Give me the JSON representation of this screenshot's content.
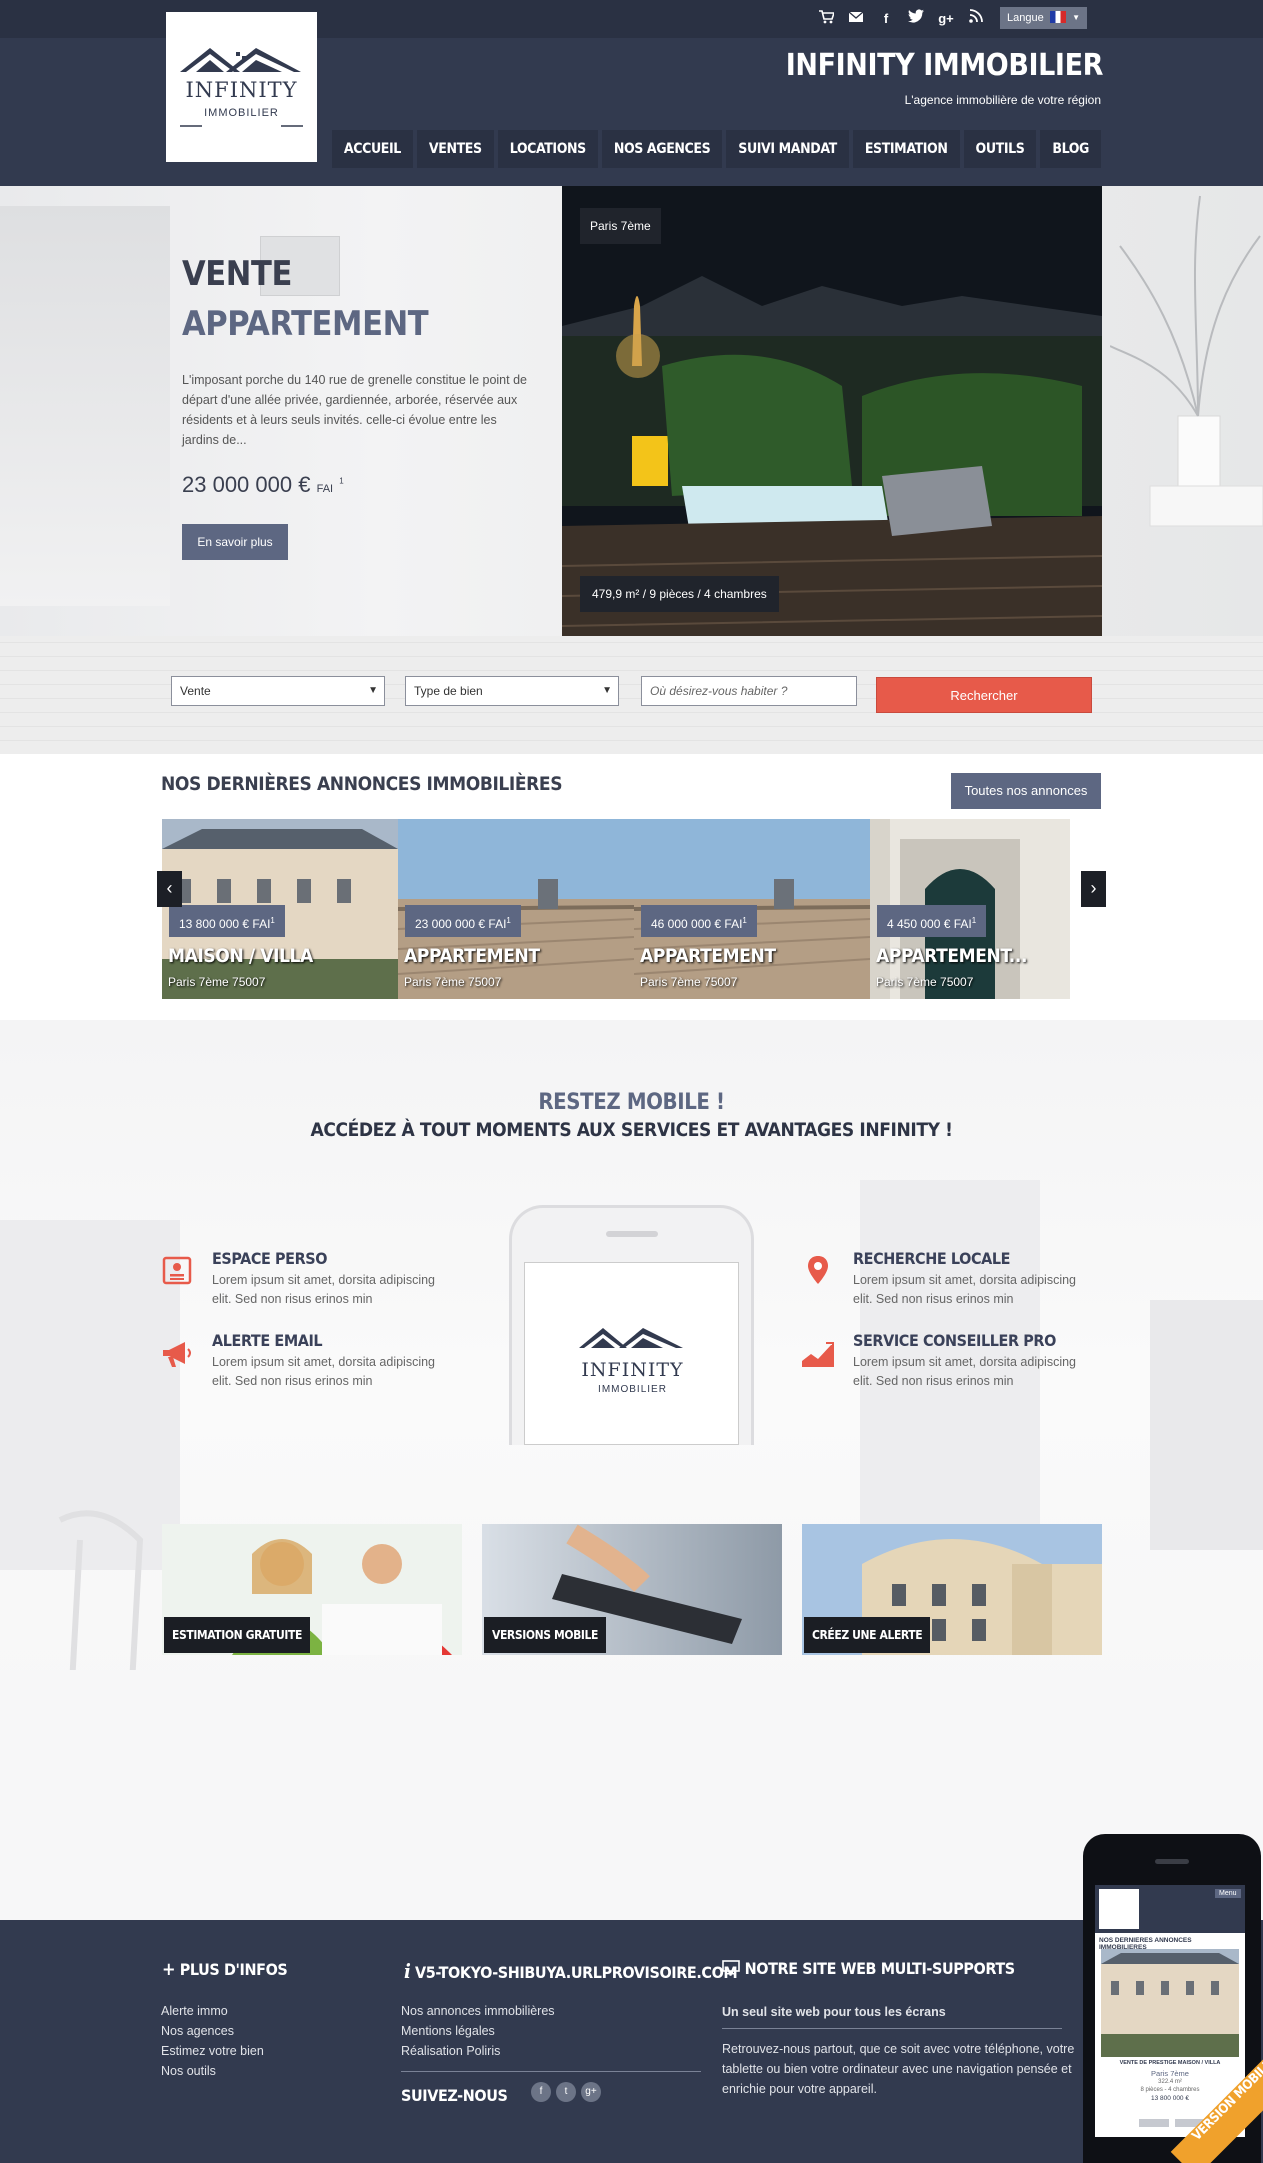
{
  "header": {
    "site_title": "INFINITY IMMOBILIER",
    "tagline": "L'agence immobilière de votre région",
    "logo_line1": "INFINITY",
    "logo_line2": "IMMOBILIER",
    "language_label": "Langue",
    "top_icons": [
      "cart-icon",
      "mail-icon",
      "facebook-icon",
      "twitter-icon",
      "googleplus-icon",
      "rss-icon"
    ],
    "nav": [
      "ACCUEIL",
      "VENTES",
      "LOCATIONS",
      "NOS AGENCES",
      "SUIVI MANDAT",
      "ESTIMATION",
      "OUTILS",
      "BLOG"
    ]
  },
  "hero": {
    "title_line1": "VENTE",
    "title_line2": "APPARTEMENT",
    "description": "L'imposant porche du 140 rue de grenelle constitue le point de départ d'une allée privée, gardiennée, arborée, réservée aux résidents et à leurs seuls invités. celle-ci évolue entre les jardins de...",
    "price": "23 000 000 €",
    "price_suffix": "FAI",
    "price_note": "1",
    "button": "En savoir plus",
    "location": "Paris 7ème",
    "specs": "479,9 m² / 9 pièces / 4 chambres"
  },
  "search": {
    "transaction": "Vente",
    "property_type": "Type de bien",
    "location_placeholder": "Où désirez-vous habiter ?",
    "button": "Rechercher"
  },
  "listings": {
    "title": "NOS DERNIÈRES ANNONCES IMMOBILIÈRES",
    "all_button": "Toutes nos annonces",
    "items": [
      {
        "price": "13 800 000 € FAI",
        "note": "1",
        "type": "MAISON / VILLA",
        "location": "Paris 7ème 75007"
      },
      {
        "price": "23 000 000 € FAI",
        "note": "1",
        "type": "APPARTEMENT",
        "location": "Paris 7ème 75007"
      },
      {
        "price": "46 000 000 € FAI",
        "note": "1",
        "type": "APPARTEMENT",
        "location": "Paris 7ème 75007"
      },
      {
        "price": "4 450 000 € FAI",
        "note": "1",
        "type": "APPARTEMENT...",
        "location": "Paris 7ème 75007"
      }
    ]
  },
  "mobile": {
    "title1": "RESTEZ MOBILE !",
    "title2": "ACCÉDEZ À TOUT MOMENTS AUX SERVICES ET AVANTAGES INFINITY !",
    "features": [
      {
        "title": "ESPACE PERSO",
        "desc": "Lorem ipsum sit amet, dorsita adipiscing elit. Sed non risus erinos min",
        "icon": "profile-icon"
      },
      {
        "title": "ALERTE EMAIL",
        "desc": "Lorem ipsum sit amet, dorsita adipiscing elit. Sed non risus erinos min",
        "icon": "megaphone-icon"
      },
      {
        "title": "RECHERCHE LOCALE",
        "desc": "Lorem ipsum sit amet, dorsita adipiscing elit. Sed non risus erinos min",
        "icon": "map-pin-icon"
      },
      {
        "title": "SERVICE CONSEILLER PRO",
        "desc": "Lorem ipsum sit amet, dorsita adipiscing elit. Sed non risus erinos min",
        "icon": "chart-icon"
      }
    ],
    "promos": [
      "ESTIMATION GRATUITE",
      "VERSIONS MOBILE",
      "CRÉEZ UNE ALERTE"
    ]
  },
  "footer": {
    "col1_title": "PLUS D'INFOS",
    "col1_links": [
      "Alerte immo",
      "Nos agences",
      "Estimez votre bien",
      "Nos outils"
    ],
    "col2_title": "V5-TOKYO-SHIBUYA.URLPROVISOIRE.COM",
    "col2_links": [
      "Nos annonces immobilières",
      "Mentions légales",
      "Réalisation Poliris"
    ],
    "social_title": "SUIVEZ-NOUS",
    "social_icons": [
      "f",
      "t",
      "g+"
    ],
    "col3_title": "NOTRE SITE WEB MULTI-SUPPORTS",
    "col3_subtitle": "Un seul site web pour tous les écrans",
    "col3_text": "Retrouvez-nous partout, que ce soit avec votre téléphone, votre tablette ou bien votre ordinateur avec une navigation pensée et enrichie pour votre appareil."
  },
  "mock_phone": {
    "menu": "Menu",
    "heading": "NOS DERNIERES ANNONCES IMMOBILIERES",
    "caption": "VENTE DE PRESTIGE MAISON / VILLA",
    "city": "Paris 7ème",
    "area": "322.4 m²",
    "rooms": "8 pièces - 4 chambres",
    "price": "13 800 000 €",
    "badge": "VERSION MOBILE"
  },
  "colors": {
    "navy": "#323a4f",
    "accent": "#e75a4a",
    "slate": "#5d6782"
  }
}
